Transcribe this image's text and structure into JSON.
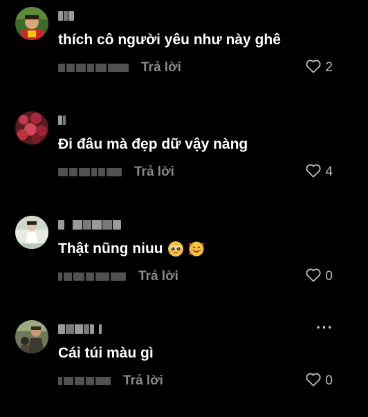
{
  "comments": [
    {
      "avatar": "avatar-child-red-shirt",
      "text": "thích cô người yêu như này ghê",
      "reply_label": "Trả lời",
      "likes": "2",
      "more": ""
    },
    {
      "avatar": "avatar-flowers",
      "text": "Đi đâu mà đẹp dữ vậy nàng",
      "reply_label": "Trả lời",
      "likes": "4",
      "more": ""
    },
    {
      "avatar": "avatar-girl-white-dress",
      "text": "Thật nũng niuu",
      "emojis": [
        "pleading-face-emoji",
        "smiling-face-with-hearts-emoji"
      ],
      "reply_label": "Trả lời",
      "likes": "0",
      "more": ""
    },
    {
      "avatar": "avatar-man-outdoors",
      "text": "Cái túi màu gì",
      "reply_label": "Trả lời",
      "likes": "0",
      "more": "···"
    }
  ],
  "colors": {
    "background": "#000000",
    "text": "#ffffff",
    "secondary": "#8a8a8a",
    "like": "#bdbdbd"
  }
}
